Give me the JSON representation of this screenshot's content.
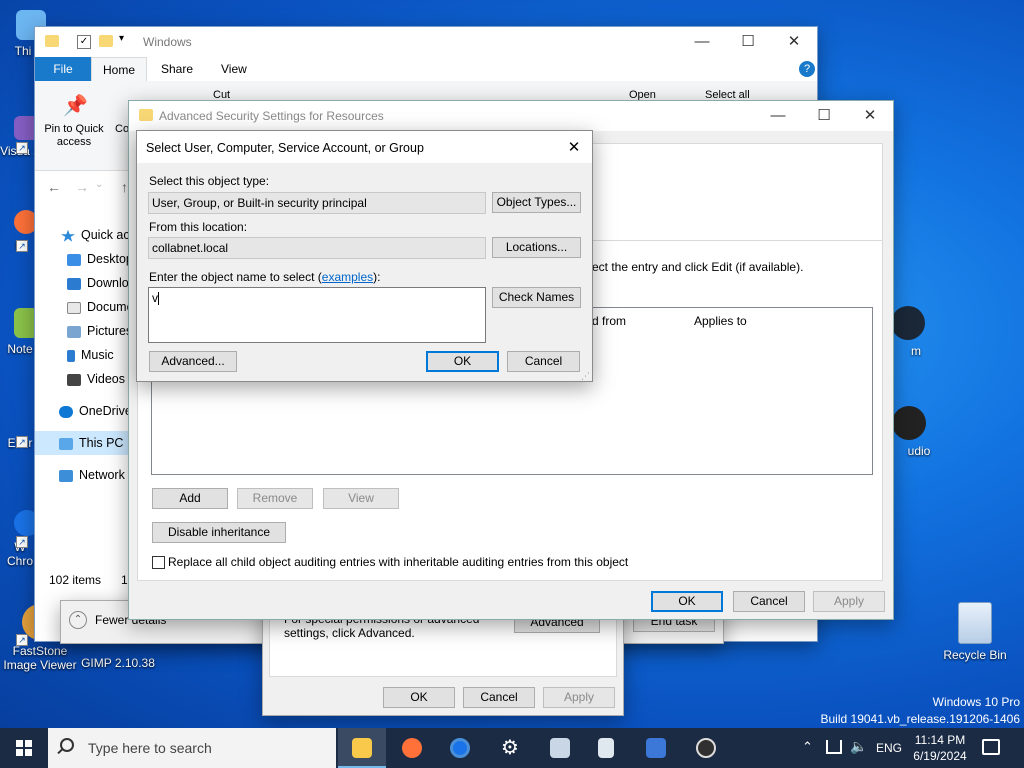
{
  "desktop": {
    "icons": [
      {
        "label": "Thi"
      },
      {
        "label": "Visua 2"
      },
      {
        "label": "Fi"
      },
      {
        "label": "Note"
      },
      {
        "label": "Ever"
      },
      {
        "label": "W Chro"
      },
      {
        "label": "FastStone Image Viewer"
      },
      {
        "label": "GIMP 2.10.38"
      },
      {
        "label": "Recycle Bin"
      },
      {
        "label": "m"
      },
      {
        "label": "udio"
      }
    ],
    "watermark": {
      "line1": "Windows 10 Pro",
      "line2": "Build 19041.vb_release.191206-1406"
    }
  },
  "explorer": {
    "title": "Windows",
    "tabs": [
      "File",
      "Home",
      "Share",
      "View"
    ],
    "ribbon": {
      "pin": "Pin to Quick access",
      "copy": "Co",
      "cut": "Cut",
      "open": "Open",
      "select_all": "Select all"
    },
    "nav": [
      "Quick acc",
      "Desktop",
      "Downlo",
      "Docume",
      "Pictures",
      "Music",
      "Videos",
      "OneDrive",
      "This PC",
      "Network"
    ],
    "status": "102 items",
    "status2": "1"
  },
  "taskmgr": {
    "fewer_details": "Fewer details",
    "end_task": "End task"
  },
  "props": {
    "hint": "For special permissions or advanced settings, click Advanced.",
    "advanced": "Advanced",
    "ok": "OK",
    "cancel": "Cancel",
    "apply": "Apply"
  },
  "adv": {
    "title": "Advanced Security Settings for Resources",
    "instruction": "ect the entry and click Edit (if available).",
    "col_from": "d from",
    "col_applies": "Applies to",
    "add": "Add",
    "remove": "Remove",
    "view": "View",
    "disable_inheritance": "Disable inheritance",
    "replace_label": "Replace all child object auditing entries with inheritable auditing entries from this object",
    "ok": "OK",
    "cancel": "Cancel",
    "apply": "Apply"
  },
  "select": {
    "title": "Select User, Computer, Service Account, or Group",
    "object_type_label": "Select this object type:",
    "object_type_value": "User, Group, or Built-in security principal",
    "object_types_btn": "Object Types...",
    "location_label": "From this location:",
    "location_value": "collabnet.local",
    "locations_btn": "Locations...",
    "enter_label_pre": "Enter the object name to select (",
    "enter_link": "examples",
    "enter_label_post": "):",
    "name_value": "v",
    "check_names": "Check Names",
    "advanced": "Advanced...",
    "ok": "OK",
    "cancel": "Cancel"
  },
  "taskbar": {
    "search_placeholder": "Type here to search",
    "lang": "ENG",
    "time": "11:14 PM",
    "date": "6/19/2024"
  },
  "colors": {
    "accent": "#0078d7",
    "taskbar": "#1c2b44",
    "link": "#0066cc"
  }
}
